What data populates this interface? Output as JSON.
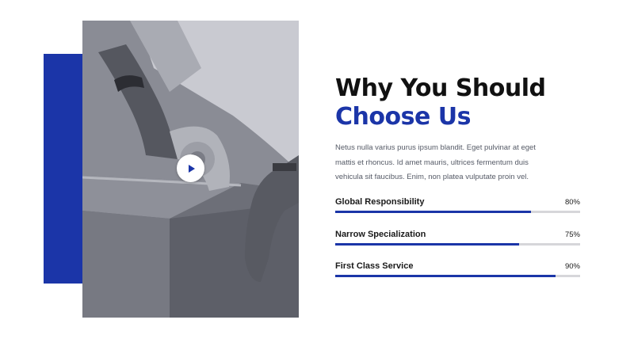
{
  "heading": {
    "line1": "Why You Should",
    "line2": "Choose Us"
  },
  "description": "Netus nulla varius purus ipsum blandit. Eget pulvinar at eget mattis et rhoncus. Id amet mauris, ultrices fermentum duis vehicula sit faucibus. Enim, non platea vulputate proin vel.",
  "video": {
    "play_icon": "play-icon"
  },
  "skills": [
    {
      "label": "Global Responsibility",
      "value": "80%",
      "percent": 80
    },
    {
      "label": "Narrow Specialization",
      "value": "75%",
      "percent": 75
    },
    {
      "label": "First Class Service",
      "value": "90%",
      "percent": 90
    }
  ],
  "colors": {
    "accent": "#1b35a8",
    "track": "#d6d6da",
    "text": "#111111"
  }
}
